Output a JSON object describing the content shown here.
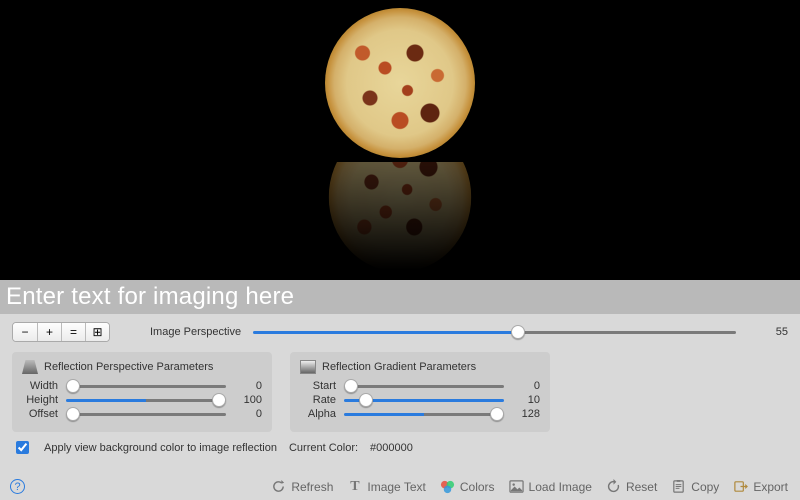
{
  "preview": {
    "image_subject": "pizza",
    "background_color": "#000000"
  },
  "text_input": {
    "placeholder": "Enter text for imaging here",
    "value": ""
  },
  "zoom_buttons": {
    "minus": "−",
    "plus": "+",
    "fit": "=",
    "actual": "⊞"
  },
  "perspective": {
    "label": "Image Perspective",
    "value": 55,
    "min": 0,
    "max": 100
  },
  "panel_reflection_perspective": {
    "title": "Reflection Perspective Parameters",
    "rows": [
      {
        "label": "Width",
        "value": 0,
        "min": 0,
        "max": 100
      },
      {
        "label": "Height",
        "value": 100,
        "min": 0,
        "max": 200
      },
      {
        "label": "Offset",
        "value": 0,
        "min": 0,
        "max": 100
      }
    ]
  },
  "panel_reflection_gradient": {
    "title": "Reflection Gradient Parameters",
    "rows": [
      {
        "label": "Start",
        "value": 0,
        "min": 0,
        "max": 100
      },
      {
        "label": "Rate",
        "value": 10,
        "min": 0,
        "max": 10
      },
      {
        "label": "Alpha",
        "value": 128,
        "min": 0,
        "max": 255
      }
    ]
  },
  "apply_bg": {
    "checked": true,
    "label": "Apply view background color to image reflection"
  },
  "current_color": {
    "label": "Current Color:",
    "value": "#000000"
  },
  "toolbar": {
    "refresh": "Refresh",
    "image_text": "Image Text",
    "colors": "Colors",
    "load_image": "Load Image",
    "reset": "Reset",
    "copy": "Copy",
    "export": "Export"
  },
  "help": "?"
}
